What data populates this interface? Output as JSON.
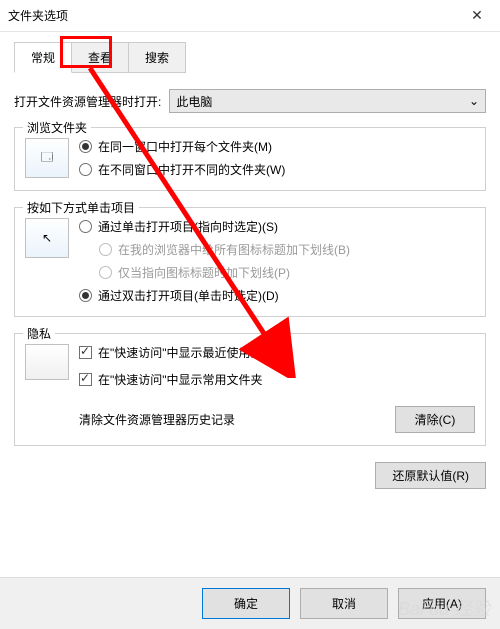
{
  "window": {
    "title": "文件夹选项"
  },
  "tabs": {
    "general": "常规",
    "view": "查看",
    "search": "搜索",
    "active": "general"
  },
  "openWith": {
    "label": "打开文件资源管理器时打开:",
    "value": "此电脑"
  },
  "browse": {
    "title": "浏览文件夹",
    "same": "在同一窗口中打开每个文件夹(M)",
    "diff": "在不同窗口中打开不同的文件夹(W)"
  },
  "click": {
    "title": "按如下方式单击项目",
    "single": "通过单击打开项目(指向时选定)(S)",
    "underlineBrowser": "在我的浏览器中给所有图标标题加下划线(B)",
    "underlinePoint": "仅当指向图标标题时加下划线(P)",
    "double": "通过双击打开项目(单击时选定)(D)"
  },
  "privacy": {
    "title": "隐私",
    "recent": "在\"快速访问\"中显示最近使用的文件",
    "frequent": "在\"快速访问\"中显示常用文件夹",
    "historyLabel": "清除文件资源管理器历史记录",
    "clearBtn": "清除(C)"
  },
  "restore": "还原默认值(R)",
  "footer": {
    "ok": "确定",
    "cancel": "取消",
    "apply": "应用(A)"
  },
  "watermark": "Bai du 经验"
}
